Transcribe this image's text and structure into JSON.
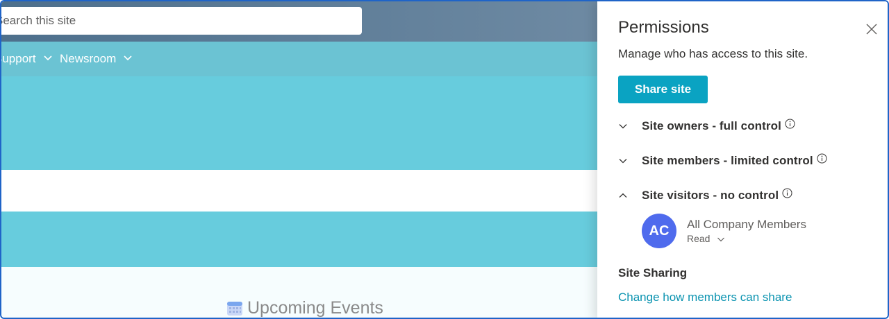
{
  "site": {
    "search": {
      "placeholder": "Search this site"
    },
    "nav": [
      {
        "label": "Support"
      },
      {
        "label": "Newsroom"
      }
    ],
    "events_title": "Upcoming Events"
  },
  "panel": {
    "title": "Permissions",
    "subtitle": "Manage who has access to this site.",
    "share_button": "Share site",
    "groups": [
      {
        "label": "Site owners - full control",
        "expanded": false
      },
      {
        "label": "Site members - limited control",
        "expanded": false
      },
      {
        "label": "Site visitors - no control",
        "expanded": true
      }
    ],
    "member": {
      "initials": "AC",
      "name": "All Company Members",
      "role": "Read"
    },
    "sharing_title": "Site Sharing",
    "sharing_link": "Change how members can share"
  },
  "colors": {
    "accent": "#0aa3c2",
    "nav_bar": "#6bc3d3",
    "hero": "#67ccdd",
    "avatar": "#4f6bed",
    "frame_border": "#1f64c8"
  },
  "icons": {
    "close": "close-icon",
    "chevron_down": "chevron-down-icon",
    "chevron_up": "chevron-up-icon",
    "info": "info-icon",
    "calendar": "calendar-icon"
  }
}
